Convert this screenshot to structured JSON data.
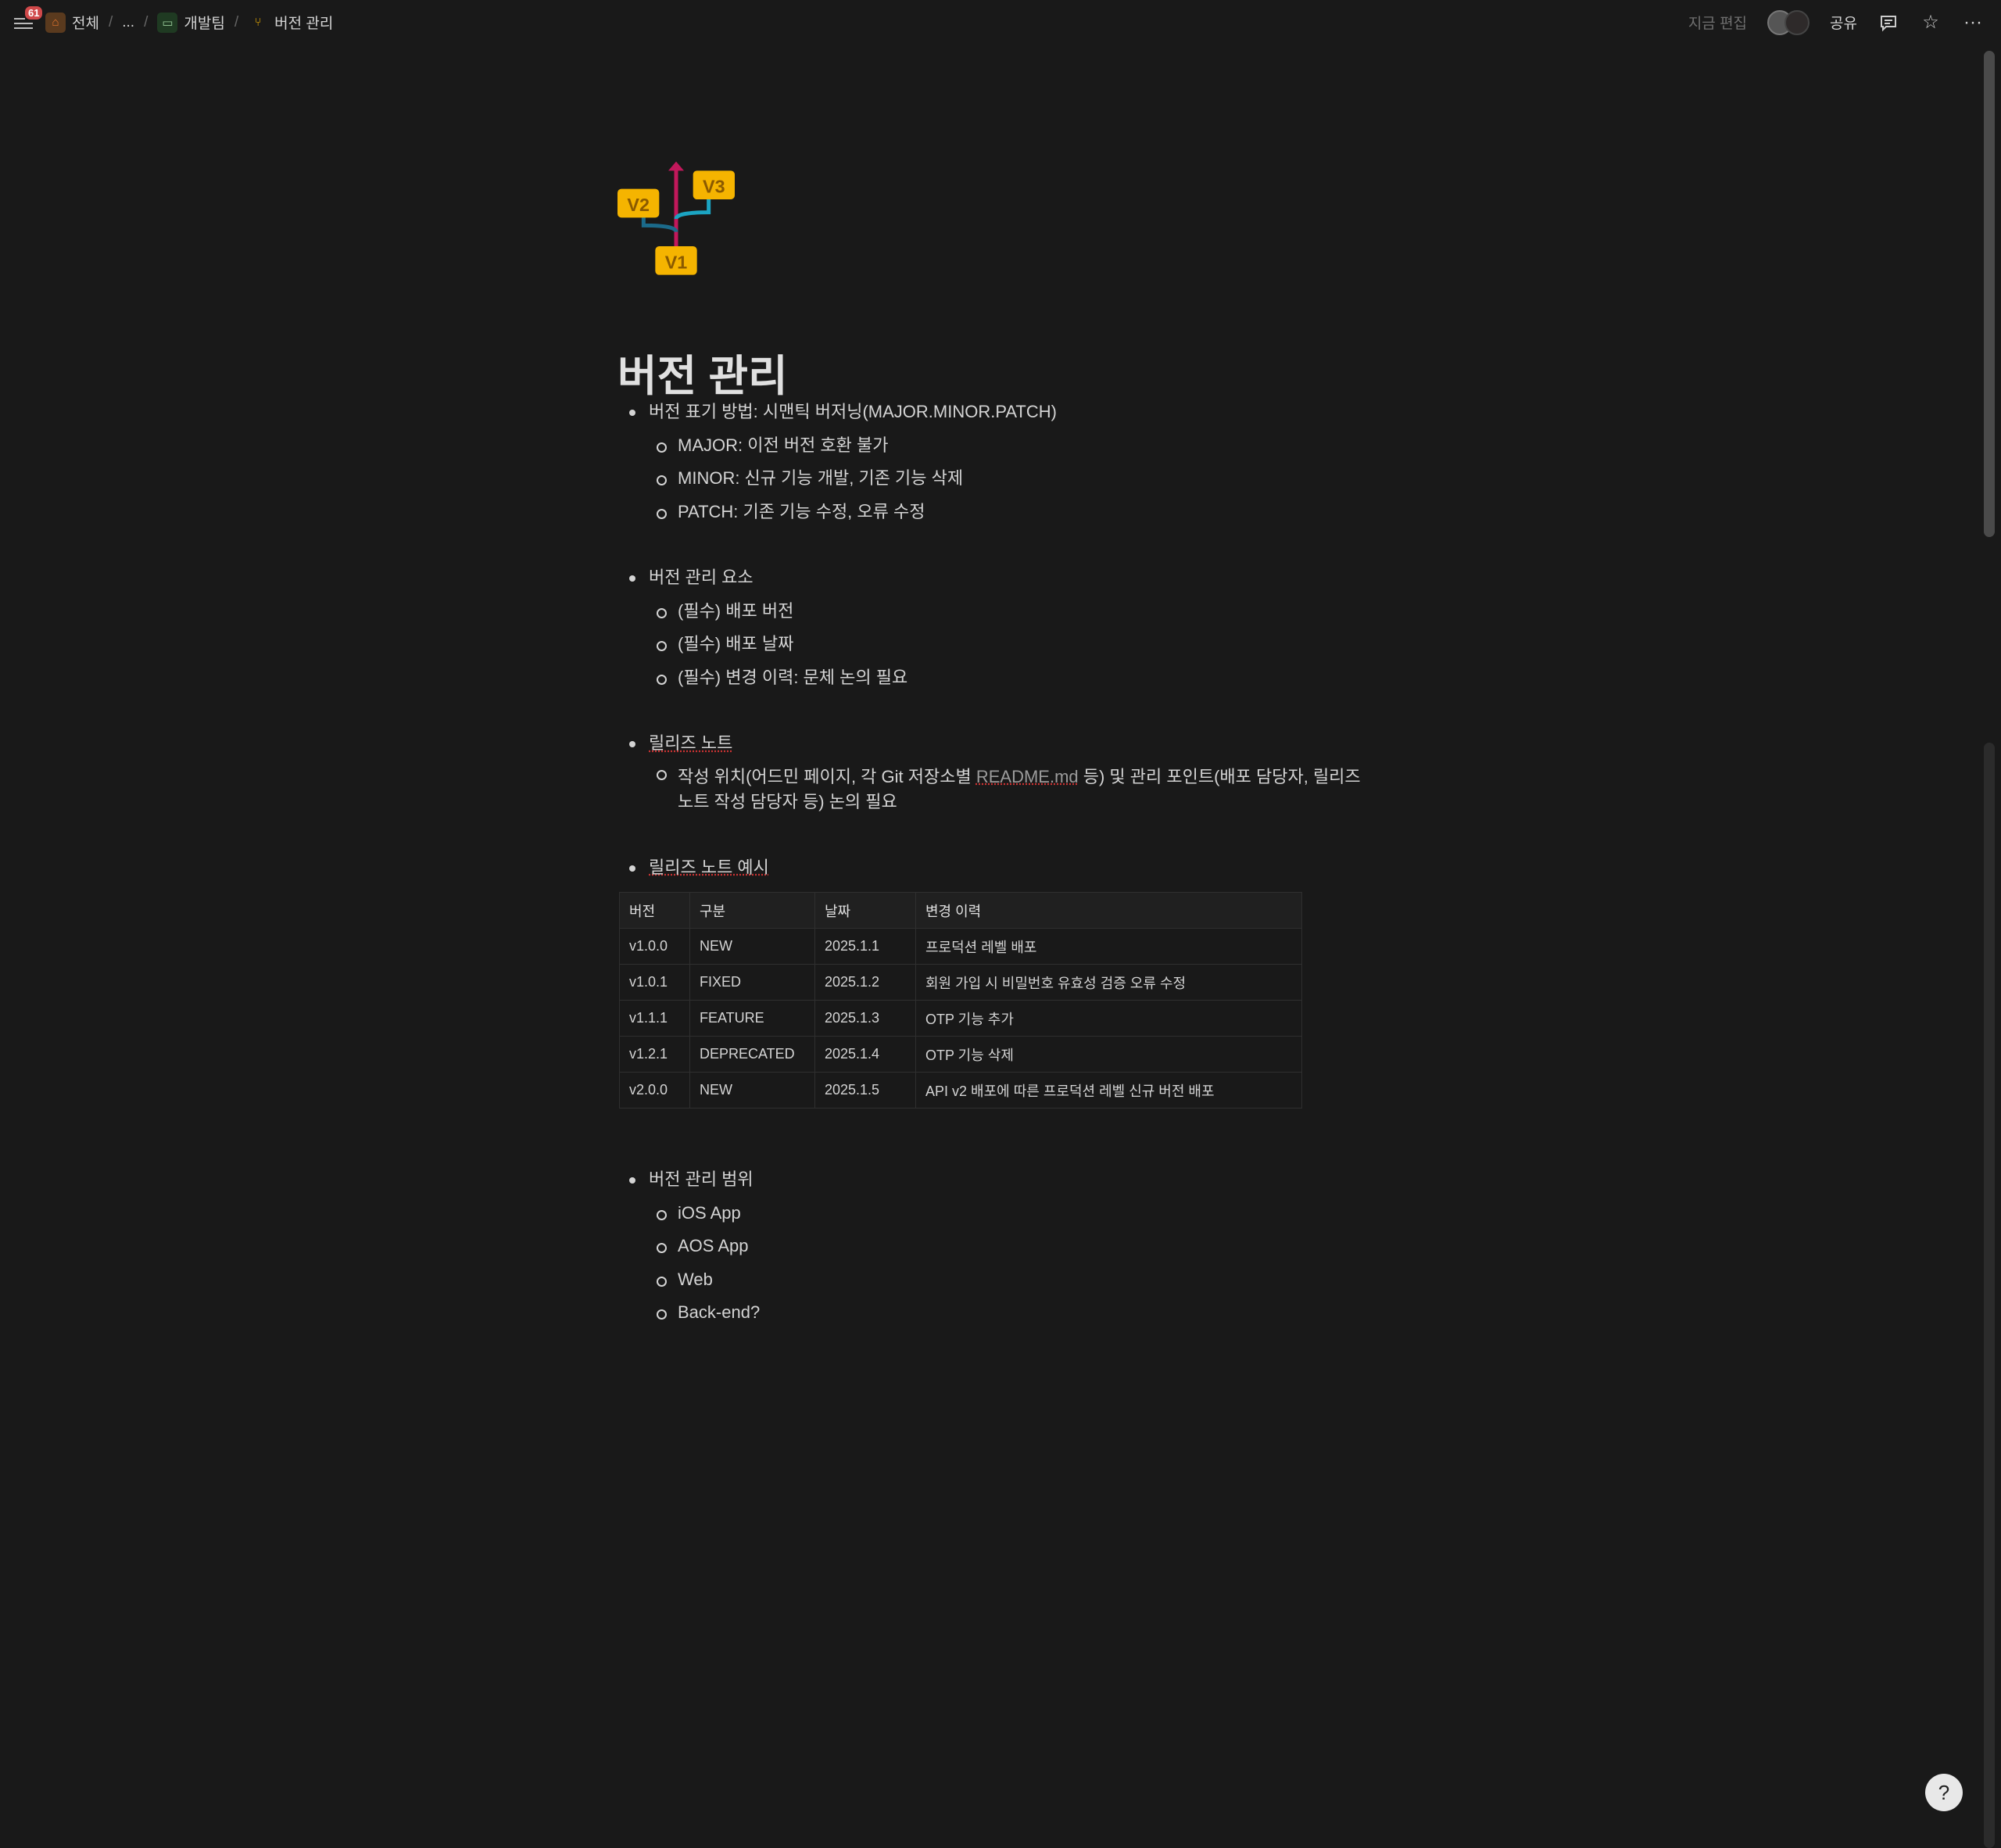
{
  "topbar": {
    "badge": "61",
    "crumbs": [
      "전체",
      "...",
      "개발팀",
      "버전 관리"
    ],
    "separator": "/",
    "editing": "지금 편집",
    "share": "공유"
  },
  "page": {
    "title": "버전 관리",
    "s1": {
      "head": "버전 표기 방법: 시맨틱 버저닝(MAJOR.MINOR.PATCH)",
      "items": [
        "MAJOR: 이전 버전 호환 불가",
        "MINOR: 신규 기능 개발, 기존 기능 삭제",
        "PATCH: 기존 기능 수정, 오류 수정"
      ]
    },
    "s2": {
      "head": "버전 관리 요소",
      "items": [
        "(필수) 배포 버전",
        "(필수) 배포 날짜",
        "(필수) 변경 이력: 문체 논의 필요"
      ]
    },
    "s3": {
      "head": "릴리즈 노트",
      "item_a": "작성 위치(어드민 페이지, 각 Git 저장소별 ",
      "link": "README.md",
      "item_b": " 등) 및 관리 포인트(배포 담당자, 릴리즈 노트 작성 담당자 등) 논의 필요"
    },
    "s4": {
      "head": "릴리즈 노트 예시"
    },
    "table": {
      "headers": [
        "버전",
        "구분",
        "날짜",
        "변경 이력"
      ],
      "rows": [
        [
          "v1.0.0",
          "NEW",
          "2025.1.1",
          "프로덕션 레벨 배포"
        ],
        [
          "v1.0.1",
          "FIXED",
          "2025.1.2",
          "회원 가입 시 비밀번호 유효성 검증 오류 수정"
        ],
        [
          "v1.1.1",
          "FEATURE",
          "2025.1.3",
          "OTP 기능 추가"
        ],
        [
          "v1.2.1",
          "DEPRECATED",
          "2025.1.4",
          "OTP 기능 삭제"
        ],
        [
          "v2.0.0",
          "NEW",
          "2025.1.5",
          "API v2 배포에 따른 프로덕션 레벨 신규 버전 배포"
        ]
      ]
    },
    "s5": {
      "head": "버전 관리 범위",
      "items": [
        "iOS App",
        "AOS App",
        "Web",
        "Back-end?"
      ]
    }
  },
  "icon": {
    "labels": [
      "V1",
      "V2",
      "V3"
    ]
  }
}
